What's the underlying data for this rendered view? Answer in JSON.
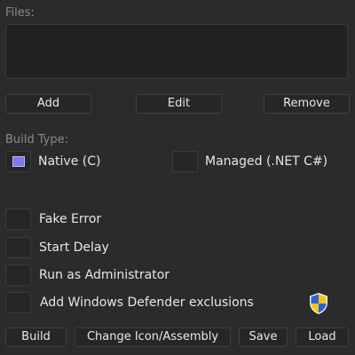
{
  "files": {
    "label": "Files:"
  },
  "file_actions": {
    "add": "Add",
    "edit": "Edit",
    "remove": "Remove"
  },
  "build_type": {
    "label": "Build Type:",
    "native": {
      "label": "Native (C)",
      "selected": true
    },
    "managed": {
      "label": "Managed (.NET C#)",
      "selected": false
    }
  },
  "options": [
    {
      "label": "Fake Error",
      "checked": false
    },
    {
      "label": "Start Delay",
      "checked": false
    },
    {
      "label": "Run as Administrator",
      "checked": false
    },
    {
      "label": "Add Windows Defender exclusions",
      "checked": false,
      "icon": "uac-shield-icon"
    }
  ],
  "bottom_actions": {
    "build": "Build",
    "change_icon": "Change Icon/Assembly",
    "save": "Save",
    "load": "Load"
  },
  "colors": {
    "background": "#2b2b2b",
    "accent": "#7d78f0"
  }
}
